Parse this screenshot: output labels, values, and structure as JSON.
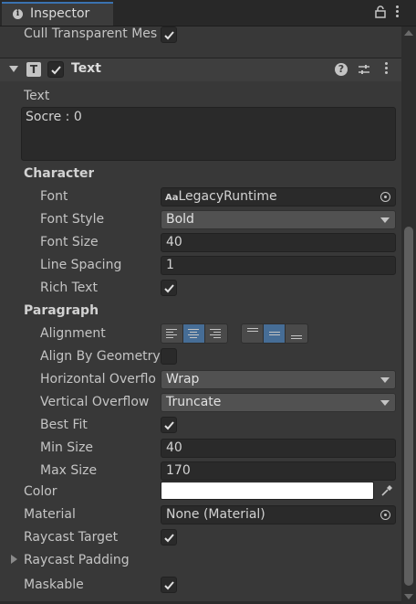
{
  "window": {
    "tab_label": "Inspector"
  },
  "top_row": {
    "label": "Cull Transparent Mes",
    "checked": true
  },
  "component": {
    "title": "Text",
    "enabled": true
  },
  "text_section": {
    "label": "Text",
    "value": "Socre : 0"
  },
  "character": {
    "heading": "Character",
    "font_label": "Font",
    "font_value": "LegacyRuntime",
    "font_style_label": "Font Style",
    "font_style_value": "Bold",
    "font_size_label": "Font Size",
    "font_size_value": "40",
    "line_spacing_label": "Line Spacing",
    "line_spacing_value": "1",
    "rich_text_label": "Rich Text",
    "rich_text_checked": true
  },
  "paragraph": {
    "heading": "Paragraph",
    "alignment_label": "Alignment",
    "horizontal_alignment_selected": "center",
    "vertical_alignment_selected": "middle",
    "align_by_geometry_label": "Align By Geometry",
    "align_by_geometry_checked": false,
    "horizontal_overflow_label": "Horizontal Overflo",
    "horizontal_overflow_value": "Wrap",
    "vertical_overflow_label": "Vertical Overflow",
    "vertical_overflow_value": "Truncate",
    "best_fit_label": "Best Fit",
    "best_fit_checked": true,
    "min_size_label": "Min Size",
    "min_size_value": "40",
    "max_size_label": "Max Size",
    "max_size_value": "170"
  },
  "color": {
    "label": "Color",
    "value": "#ffffff"
  },
  "material": {
    "label": "Material",
    "value": "None (Material)"
  },
  "raycast_target": {
    "label": "Raycast Target",
    "checked": true
  },
  "raycast_padding": {
    "label": "Raycast Padding"
  },
  "maskable": {
    "label": "Maskable",
    "checked": true
  },
  "icons": [
    "info-icon",
    "lock-icon",
    "kebab-menu-icon",
    "text-component-icon",
    "help-icon",
    "presets-icon",
    "object-picker-icon",
    "eyedropper-icon"
  ]
}
